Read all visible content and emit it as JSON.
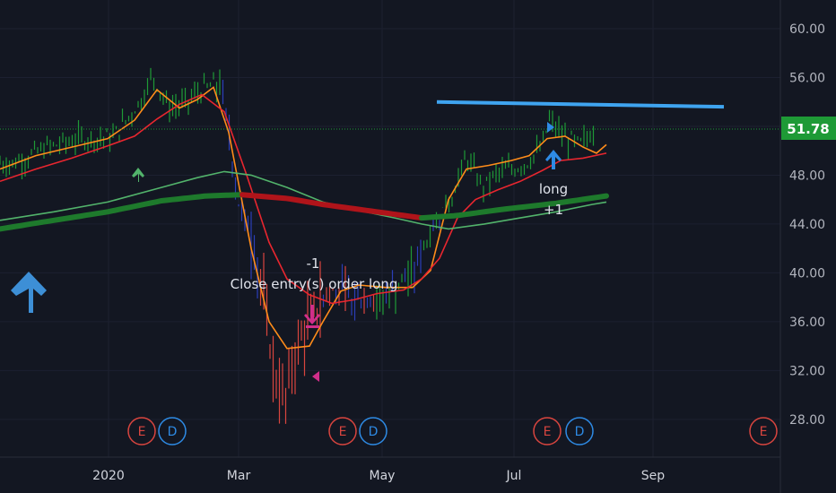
{
  "chart_data": {
    "type": "candlestick",
    "price_axis": {
      "ticks": [
        "60.00",
        "56.00",
        "52.00",
        "48.00",
        "44.00",
        "40.00",
        "36.00",
        "32.00",
        "28.00"
      ],
      "range": [
        25.6,
        62.3
      ],
      "current_price": "51.78",
      "current_price_color": "#1e9a36"
    },
    "time_axis": {
      "ticks": [
        "2020",
        "Mar",
        "May",
        "Jul",
        "Sep"
      ]
    },
    "price_series": [
      {
        "date": "2019-11-20",
        "close": 49.0
      },
      {
        "date": "2019-12-05",
        "close": 50.3
      },
      {
        "date": "2019-12-20",
        "close": 51.0
      },
      {
        "date": "2020-01-03",
        "close": 51.1
      },
      {
        "date": "2020-01-15",
        "close": 54.0
      },
      {
        "date": "2020-01-21",
        "close": 56.2
      },
      {
        "date": "2020-01-28",
        "close": 53.5
      },
      {
        "date": "2020-02-04",
        "close": 53.8
      },
      {
        "date": "2020-02-12",
        "close": 55.0
      },
      {
        "date": "2020-02-20",
        "close": 55.5
      },
      {
        "date": "2020-02-24",
        "close": 51.6
      },
      {
        "date": "2020-02-28",
        "close": 46.0
      },
      {
        "date": "2020-03-05",
        "close": 43.0
      },
      {
        "date": "2020-03-10",
        "close": 39.0
      },
      {
        "date": "2020-03-13",
        "close": 34.5
      },
      {
        "date": "2020-03-17",
        "close": 30.5
      },
      {
        "date": "2020-03-20",
        "close": 29.5
      },
      {
        "date": "2020-03-25",
        "close": 33.5
      },
      {
        "date": "2020-03-31",
        "close": 36.0
      },
      {
        "date": "2020-04-06",
        "close": 38.0
      },
      {
        "date": "2020-04-13",
        "close": 38.8
      },
      {
        "date": "2020-04-20",
        "close": 37.5
      },
      {
        "date": "2020-04-27",
        "close": 37.8
      },
      {
        "date": "2020-05-04",
        "close": 38.2
      },
      {
        "date": "2020-05-11",
        "close": 38.8
      },
      {
        "date": "2020-05-18",
        "close": 40.5
      },
      {
        "date": "2020-05-26",
        "close": 44.0
      },
      {
        "date": "2020-06-03",
        "close": 46.2
      },
      {
        "date": "2020-06-10",
        "close": 49.5
      },
      {
        "date": "2020-06-17",
        "close": 47.0
      },
      {
        "date": "2020-06-24",
        "close": 48.2
      },
      {
        "date": "2020-07-01",
        "close": 48.5
      },
      {
        "date": "2020-07-08",
        "close": 49.2
      },
      {
        "date": "2020-07-14",
        "close": 50.3
      },
      {
        "date": "2020-07-17",
        "close": 52.5
      },
      {
        "date": "2020-07-24",
        "close": 51.0
      },
      {
        "date": "2020-07-31",
        "close": 50.5
      },
      {
        "date": "2020-08-07",
        "close": 51.78
      }
    ],
    "moving_averages": [
      {
        "color": "#ff8c1a",
        "values": [
          [
            0,
            48.5
          ],
          [
            40,
            49.6
          ],
          [
            80,
            50.3
          ],
          [
            120,
            51.0
          ],
          [
            150,
            52.5
          ],
          [
            175,
            55.0
          ],
          [
            200,
            53.5
          ],
          [
            220,
            54.2
          ],
          [
            238,
            55.2
          ],
          [
            255,
            51.5
          ],
          [
            280,
            42.0
          ],
          [
            300,
            36.0
          ],
          [
            320,
            33.8
          ],
          [
            345,
            34.0
          ],
          [
            360,
            36.0
          ],
          [
            380,
            38.5
          ],
          [
            400,
            39.0
          ],
          [
            430,
            38.8
          ],
          [
            460,
            38.8
          ],
          [
            480,
            40.2
          ],
          [
            500,
            46.0
          ],
          [
            520,
            48.5
          ],
          [
            545,
            48.8
          ],
          [
            570,
            49.2
          ],
          [
            590,
            49.6
          ],
          [
            610,
            51.0
          ],
          [
            630,
            51.2
          ],
          [
            650,
            50.3
          ],
          [
            665,
            49.8
          ],
          [
            676,
            50.5
          ]
        ]
      },
      {
        "color": "#e8262f",
        "values": [
          [
            0,
            47.5
          ],
          [
            40,
            48.5
          ],
          [
            80,
            49.4
          ],
          [
            120,
            50.4
          ],
          [
            150,
            51.2
          ],
          [
            175,
            52.6
          ],
          [
            200,
            53.8
          ],
          [
            225,
            54.6
          ],
          [
            250,
            53.2
          ],
          [
            275,
            48.0
          ],
          [
            300,
            42.5
          ],
          [
            320,
            39.5
          ],
          [
            345,
            38.2
          ],
          [
            370,
            37.5
          ],
          [
            395,
            37.8
          ],
          [
            420,
            38.3
          ],
          [
            450,
            38.6
          ],
          [
            470,
            39.5
          ],
          [
            490,
            41.2
          ],
          [
            510,
            44.5
          ],
          [
            530,
            46.0
          ],
          [
            555,
            46.8
          ],
          [
            580,
            47.5
          ],
          [
            605,
            48.4
          ],
          [
            625,
            49.2
          ],
          [
            650,
            49.4
          ],
          [
            676,
            49.8
          ]
        ]
      },
      {
        "color": "#52b36b",
        "values": [
          [
            0,
            44.3
          ],
          [
            60,
            45.0
          ],
          [
            120,
            45.8
          ],
          [
            180,
            47.0
          ],
          [
            220,
            47.8
          ],
          [
            250,
            48.3
          ],
          [
            280,
            48.0
          ],
          [
            320,
            47.0
          ],
          [
            360,
            45.8
          ],
          [
            400,
            45.1
          ],
          [
            440,
            44.5
          ],
          [
            470,
            44.0
          ],
          [
            500,
            43.6
          ],
          [
            540,
            44.0
          ],
          [
            580,
            44.5
          ],
          [
            620,
            45.0
          ],
          [
            660,
            45.6
          ],
          [
            676,
            45.8
          ]
        ]
      }
    ],
    "trend_ma": {
      "values": [
        [
          0,
          43.6
        ],
        [
          60,
          44.3
        ],
        [
          120,
          45.0
        ],
        [
          180,
          45.9
        ],
        [
          230,
          46.3
        ],
        [
          270,
          46.4
        ],
        [
          320,
          46.1
        ],
        [
          360,
          45.6
        ],
        [
          400,
          45.2
        ],
        [
          440,
          44.8
        ],
        [
          470,
          44.5
        ],
        [
          510,
          44.7
        ],
        [
          560,
          45.2
        ],
        [
          620,
          45.7
        ],
        [
          676,
          46.3
        ]
      ],
      "segments": [
        {
          "from": 0,
          "to": 270,
          "color": "#1e7a2c"
        },
        {
          "from": 270,
          "to": 470,
          "color": "#b0141a"
        },
        {
          "from": 470,
          "to": 676,
          "color": "#1e7a2c"
        }
      ]
    },
    "horizontal_line": {
      "value": 54.0,
      "end_value": 53.6,
      "color": "#3fa4f0"
    },
    "annotations": {
      "exit_label": "Close entry(s) order long",
      "exit_qty": "-1",
      "entry_label": "long",
      "entry_qty": "+1"
    },
    "events": [
      {
        "letters": [
          "E",
          "D"
        ]
      },
      {
        "letters": [
          "E",
          "D"
        ]
      },
      {
        "letters": [
          "E",
          "D"
        ]
      },
      {
        "letters": [
          "E"
        ]
      }
    ],
    "colors": {
      "background": "#131722",
      "earnings": "#d9453f",
      "dividend": "#2e8be5",
      "bull_bar": "#1e9a36",
      "bear_bar": "#d9453f",
      "neutral_bar": "#2b3fb8",
      "buy_arrow": "#2e8be5",
      "sell_arrow": "#d12e8a"
    }
  }
}
